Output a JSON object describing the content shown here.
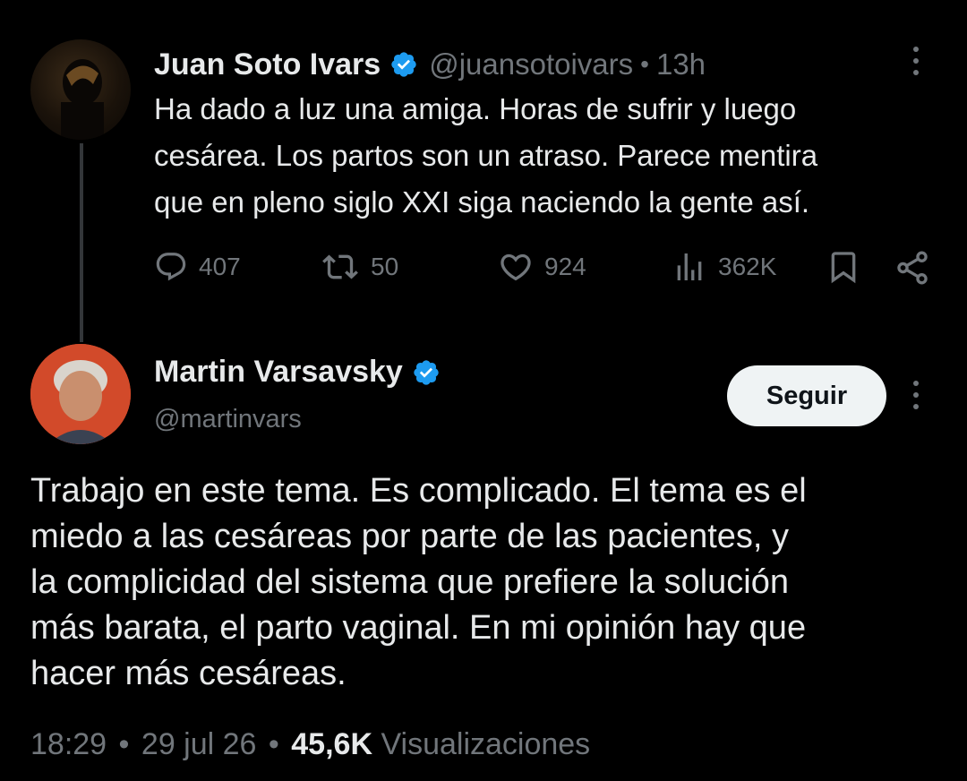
{
  "original_tweet": {
    "author_name": "Juan Soto Ivars",
    "handle": "@juansotoivars",
    "separator": "•",
    "time": "13h",
    "text_lines": [
      "Ha dado a luz una amiga. Horas de sufrir y luego",
      "cesárea. Los partos son un atraso. Parece mentira",
      "que en pleno siglo XXI siga naciendo la gente así."
    ],
    "replies": "407",
    "reposts": "50",
    "likes": "924",
    "views": "362K",
    "icons": [
      "more-icon",
      "reply-icon",
      "repost-icon",
      "like-icon",
      "views-icon",
      "bookmark-icon",
      "share-icon",
      "verified-badge-icon"
    ]
  },
  "reply_tweet": {
    "author_name": "Martin Varsavsky",
    "handle": "@martinvars",
    "follow_label": "Seguir",
    "text_lines": [
      "Trabajo en este tema. Es complicado. El tema es el",
      "miedo a las cesáreas por parte de las pacientes, y",
      "la complicidad del sistema que prefiere la solución",
      "más barata, el parto vaginal. En mi opinión hay que",
      "hacer más cesáreas."
    ],
    "time": "18:29",
    "date": "29 jul 26",
    "views": "45,6K",
    "views_label": "Visualizaciones",
    "separator": "•"
  },
  "colors": {
    "background": "#000000",
    "text": "#e7e9ea",
    "muted": "#71767b",
    "verified": "#1d9bf0",
    "follow_bg": "#eff3f4"
  }
}
